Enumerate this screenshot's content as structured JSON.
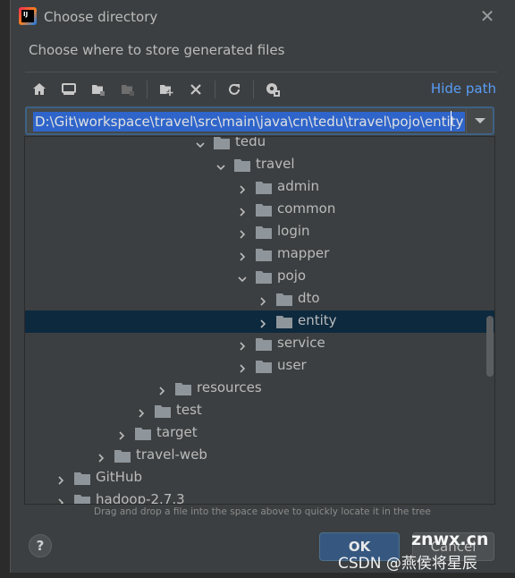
{
  "dialog": {
    "title": "Choose directory",
    "subtitle": "Choose where to store generated files",
    "hide_path": "Hide path",
    "path": "D:\\Git\\workspace\\travel\\src\\main\\java\\cn\\tedu\\travel\\pojo\\entity",
    "hint": "Drag and drop a file into the space above to quickly locate it in the tree",
    "help": "?",
    "ok": "OK",
    "cancel": "Cancel"
  },
  "toolbar": [
    "home-icon",
    "desktop-icon",
    "project-folder-icon",
    "module-folder-icon",
    "new-folder-icon",
    "delete-icon",
    "refresh-icon",
    "show-hidden-icon"
  ],
  "tree": [
    {
      "label": "tedu",
      "expanded": true
    },
    {
      "label": "travel",
      "expanded": true
    },
    {
      "label": "admin",
      "expanded": false
    },
    {
      "label": "common",
      "expanded": false
    },
    {
      "label": "login",
      "expanded": false
    },
    {
      "label": "mapper",
      "expanded": false
    },
    {
      "label": "pojo",
      "expanded": true
    },
    {
      "label": "dto",
      "expanded": false
    },
    {
      "label": "entity",
      "expanded": false,
      "selected": true
    },
    {
      "label": "service",
      "expanded": false
    },
    {
      "label": "user",
      "expanded": false
    },
    {
      "label": "resources",
      "expanded": false
    },
    {
      "label": "test",
      "expanded": false
    },
    {
      "label": "target",
      "expanded": false
    },
    {
      "label": "travel-web",
      "expanded": false
    },
    {
      "label": "GitHub",
      "expanded": false
    },
    {
      "label": "hadoop-2.7.3",
      "expanded": false
    }
  ],
  "watermark": {
    "site": "znwx.cn",
    "credit": "CSDN @燕侯将星辰"
  },
  "colors": {
    "accent": "#589df6",
    "selection": "#0d293e",
    "path_highlight": "#2f65ca",
    "ok_button": "#365880"
  }
}
